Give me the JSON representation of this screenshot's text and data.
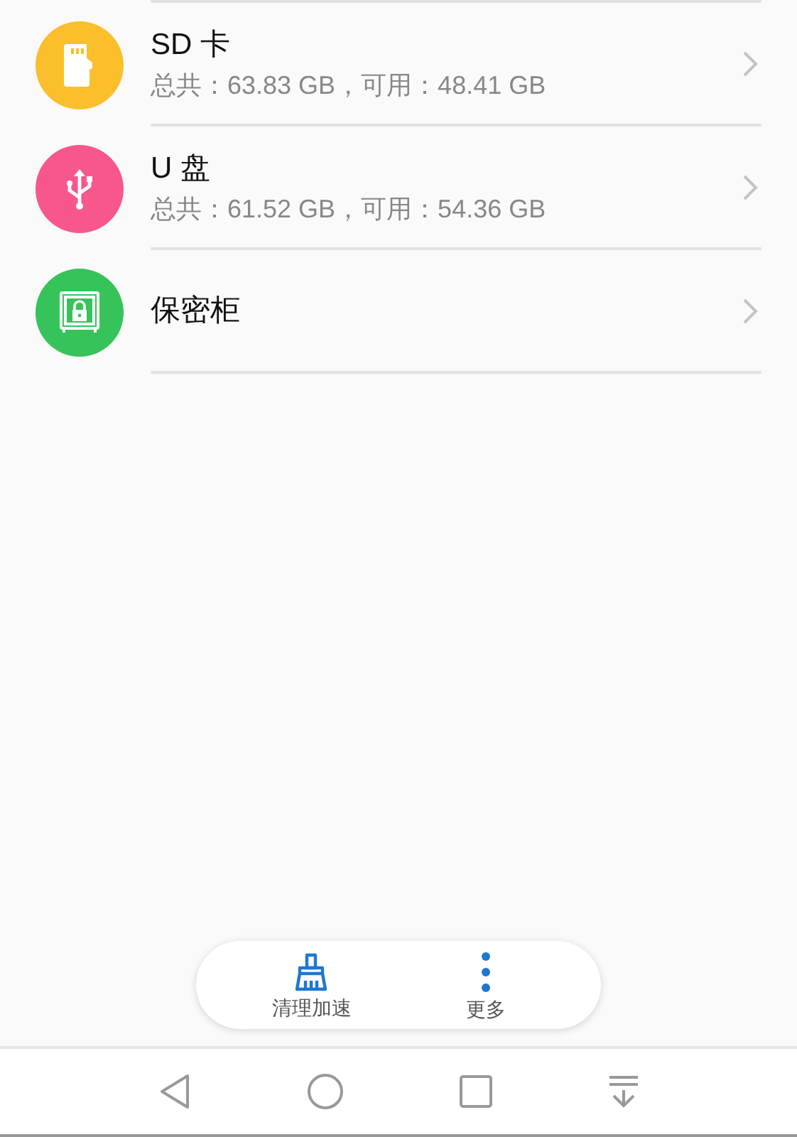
{
  "storage_items": [
    {
      "kind": "sd",
      "color": "#fbbf2c",
      "title": "SD 卡",
      "detail": "总共：63.83 GB，可用：48.41 GB"
    },
    {
      "kind": "usb",
      "color": "#f7578c",
      "title": "U 盘",
      "detail": "总共：61.52 GB，可用：54.36 GB"
    },
    {
      "kind": "safe",
      "color": "#36c45a",
      "title": "保密柜"
    }
  ],
  "action_bar": [
    {
      "kind": "clean",
      "label": "清理加速"
    },
    {
      "kind": "more",
      "label": "更多"
    }
  ],
  "nav_bar": [
    {
      "kind": "back"
    },
    {
      "kind": "home"
    },
    {
      "kind": "recents"
    },
    {
      "kind": "notifications"
    }
  ]
}
